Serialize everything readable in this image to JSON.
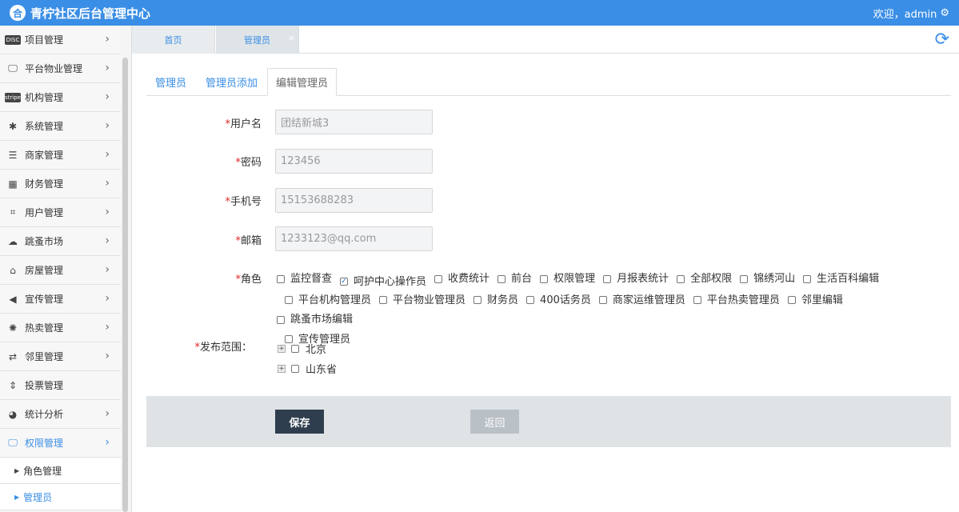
{
  "header": {
    "title": "青柠社区后台管理中心",
    "logo_glyph": "合",
    "welcome": "欢迎，admin",
    "settings_icon": "gear-icon"
  },
  "sidebar": {
    "items": [
      {
        "label": "项目管理",
        "icon": "discover-card-icon",
        "glyph": "DISC"
      },
      {
        "label": "平台物业管理",
        "icon": "monitor-icon",
        "glyph": "🖵"
      },
      {
        "label": "机构管理",
        "icon": "stripe-icon",
        "glyph": "stripe"
      },
      {
        "label": "系统管理",
        "icon": "yelp-icon",
        "glyph": "✱"
      },
      {
        "label": "商家管理",
        "icon": "list-icon",
        "glyph": "☰"
      },
      {
        "label": "财务管理",
        "icon": "calculator-icon",
        "glyph": "▦"
      },
      {
        "label": "用户管理",
        "icon": "crop-icon",
        "glyph": "⌗"
      },
      {
        "label": "跳蚤市场",
        "icon": "cloud-icon",
        "glyph": "☁"
      },
      {
        "label": "房屋管理",
        "icon": "bank-icon",
        "glyph": "⌂"
      },
      {
        "label": "宣传管理",
        "icon": "volume-icon",
        "glyph": "◀"
      },
      {
        "label": "热卖管理",
        "icon": "sun-icon",
        "glyph": "✺"
      },
      {
        "label": "邻里管理",
        "icon": "retweet-icon",
        "glyph": "⇄"
      },
      {
        "label": "投票管理",
        "icon": "sort-icon",
        "glyph": "⇕"
      },
      {
        "label": "统计分析",
        "icon": "pie-chart-icon",
        "glyph": "◕"
      },
      {
        "label": "权限管理",
        "icon": "desktop-icon",
        "glyph": "🖵"
      }
    ],
    "subitems": [
      {
        "label": "角色管理"
      },
      {
        "label": "管理员"
      }
    ]
  },
  "page_tabs": [
    {
      "label": "首页"
    },
    {
      "label": "管理员",
      "close": "×"
    }
  ],
  "sub_tabs": [
    {
      "label": "管理员"
    },
    {
      "label": "管理员添加"
    },
    {
      "label": "编辑管理员"
    }
  ],
  "form": {
    "required_mark": "*",
    "username": {
      "label": "用户名",
      "value": "团结新城3"
    },
    "password": {
      "label": "密码",
      "value": "123456"
    },
    "phone": {
      "label": "手机号",
      "value": "15153688283"
    },
    "email": {
      "label": "邮箱",
      "value": "1233123@qq.com"
    },
    "role_label": "角色",
    "roles": [
      {
        "label": "监控督查",
        "checked": false
      },
      {
        "label": "呵护中心操作员",
        "checked": true
      },
      {
        "label": "收费统计",
        "checked": false
      },
      {
        "label": "前台",
        "checked": false
      },
      {
        "label": "权限管理",
        "checked": false
      },
      {
        "label": "月报表统计",
        "checked": false
      },
      {
        "label": "全部权限",
        "checked": false
      },
      {
        "label": "锦绣河山",
        "checked": false
      },
      {
        "label": "生活百科编辑",
        "checked": false
      },
      {
        "label": "平台机构管理员",
        "checked": false
      },
      {
        "label": "平台物业管理员",
        "checked": false
      },
      {
        "label": "财务员",
        "checked": false
      },
      {
        "label": "400话务员",
        "checked": false
      },
      {
        "label": "商家运维管理员",
        "checked": false
      },
      {
        "label": "平台热卖管理员",
        "checked": false
      },
      {
        "label": "邻里编辑",
        "checked": false
      },
      {
        "label": "跳蚤市场编辑",
        "checked": false
      },
      {
        "label": "宣传管理员",
        "checked": false
      }
    ],
    "scope_label": "发布范围：",
    "scope_tree": [
      {
        "label": "北京"
      },
      {
        "label": "山东省"
      }
    ],
    "save_label": "保存",
    "back_label": "返回"
  },
  "colors": {
    "primary": "#3a8ee6",
    "save_bg": "#2f3e4f",
    "back_bg": "#b9c0c6",
    "required": "#e02424"
  }
}
